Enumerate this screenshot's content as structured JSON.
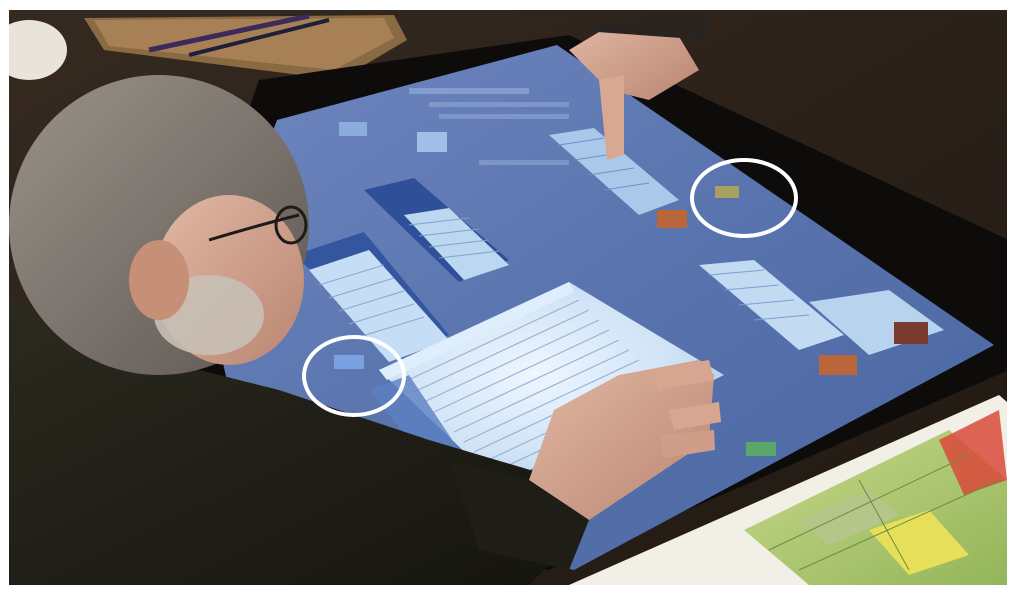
{
  "photo": {
    "subject": "",
    "colors": {
      "room": "#141210",
      "table_top": "#2e241c",
      "screen_glow": "#4f69a6",
      "screen_surface": "#5673ae",
      "window_fill": "#b8d6ee",
      "highlight_ring": "#ffffff",
      "paper_map_green": "#a8c46a",
      "paper_map_yellow": "#e6df59",
      "accent_orange": "#b8663a",
      "accent_green": "#5aa86a"
    }
  }
}
